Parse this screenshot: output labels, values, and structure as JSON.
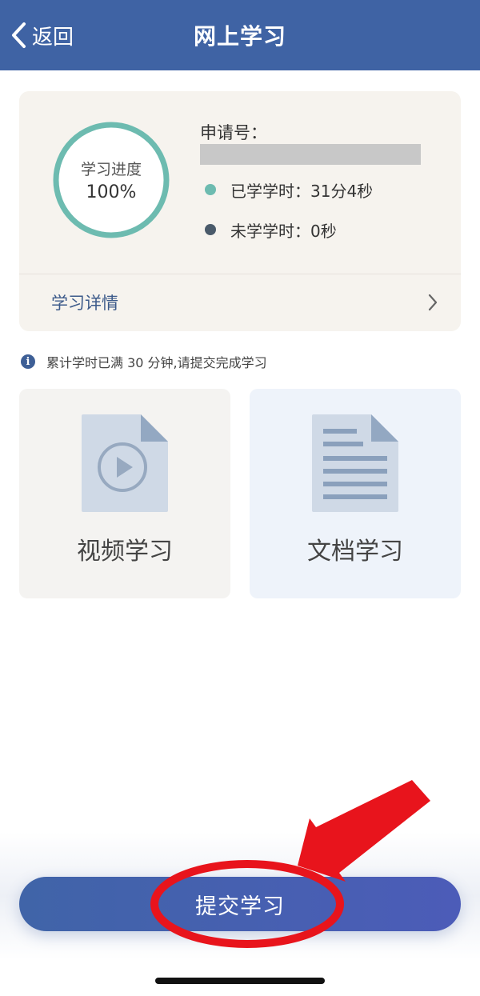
{
  "header": {
    "back_label": "返回",
    "title": "网上学习"
  },
  "progress": {
    "ring_label": "学习进度",
    "ring_value": "100%",
    "percent": 100,
    "apply_label": "申请号：",
    "learned_text": "已学学时：31分4秒",
    "remaining_text": "未学学时：0秒",
    "detail_label": "学习详情"
  },
  "notice": {
    "text": "累计学时已满 30 分钟,请提交完成学习"
  },
  "tiles": {
    "video_label": "视频学习",
    "doc_label": "文档学习"
  },
  "submit": {
    "label": "提交学习"
  },
  "colors": {
    "header": "#3f63a4",
    "ring": "#6dbbb0",
    "learned_dot": "#6dbbb0",
    "remaining_dot": "#4a5a6a",
    "annotation": "#e8141c"
  },
  "icons": {
    "back": "chevron-left-icon",
    "detail": "chevron-right-icon",
    "notice": "info-icon",
    "video": "video-file-icon",
    "doc": "document-file-icon"
  }
}
